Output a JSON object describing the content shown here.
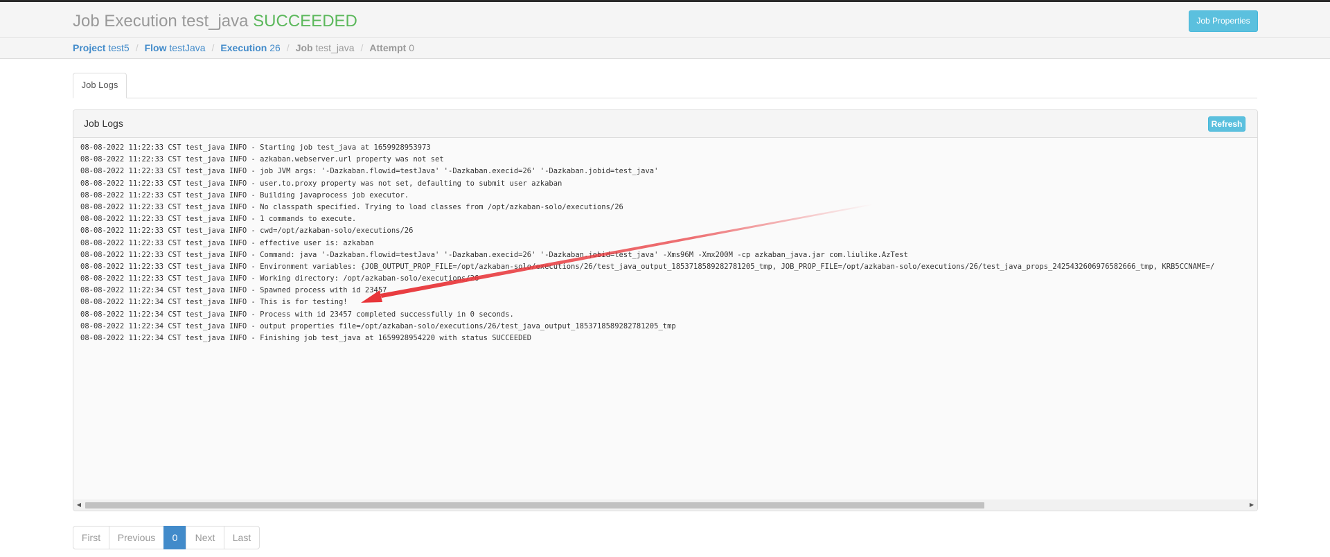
{
  "header": {
    "title_prefix": "Job Execution test_java",
    "status": "SUCCEEDED",
    "status_color": "#5cb85c",
    "job_properties_label": "Job Properties"
  },
  "breadcrumb": {
    "project": {
      "key": "Project",
      "value": "test5"
    },
    "flow": {
      "key": "Flow",
      "value": "testJava"
    },
    "execution": {
      "key": "Execution",
      "value": "26"
    },
    "job": {
      "key": "Job",
      "value": "test_java"
    },
    "attempt": {
      "key": "Attempt",
      "value": "0"
    },
    "separator": "/"
  },
  "tabs": [
    {
      "label": "Job Logs"
    }
  ],
  "panel": {
    "title": "Job Logs",
    "refresh_label": "Refresh"
  },
  "log_lines": [
    "08-08-2022 11:22:33 CST test_java INFO - Starting job test_java at 1659928953973",
    "08-08-2022 11:22:33 CST test_java INFO - azkaban.webserver.url property was not set",
    "08-08-2022 11:22:33 CST test_java INFO - job JVM args: '-Dazkaban.flowid=testJava' '-Dazkaban.execid=26' '-Dazkaban.jobid=test_java'",
    "08-08-2022 11:22:33 CST test_java INFO - user.to.proxy property was not set, defaulting to submit user azkaban",
    "08-08-2022 11:22:33 CST test_java INFO - Building javaprocess job executor.",
    "08-08-2022 11:22:33 CST test_java INFO - No classpath specified. Trying to load classes from /opt/azkaban-solo/executions/26",
    "08-08-2022 11:22:33 CST test_java INFO - 1 commands to execute.",
    "08-08-2022 11:22:33 CST test_java INFO - cwd=/opt/azkaban-solo/executions/26",
    "08-08-2022 11:22:33 CST test_java INFO - effective user is: azkaban",
    "08-08-2022 11:22:33 CST test_java INFO - Command: java '-Dazkaban.flowid=testJava' '-Dazkaban.execid=26' '-Dazkaban.jobid=test_java' -Xms96M -Xmx200M -cp azkaban_java.jar com.liulike.AzTest",
    "08-08-2022 11:22:33 CST test_java INFO - Environment variables: {JOB_OUTPUT_PROP_FILE=/opt/azkaban-solo/executions/26/test_java_output_1853718589282781205_tmp, JOB_PROP_FILE=/opt/azkaban-solo/executions/26/test_java_props_2425432606976582666_tmp, KRB5CCNAME=/",
    "08-08-2022 11:22:33 CST test_java INFO - Working directory: /opt/azkaban-solo/executions/26",
    "08-08-2022 11:22:34 CST test_java INFO - Spawned process with id 23457",
    "08-08-2022 11:22:34 CST test_java INFO - This is for testing!",
    "08-08-2022 11:22:34 CST test_java INFO - Process with id 23457 completed successfully in 0 seconds.",
    "08-08-2022 11:22:34 CST test_java INFO - output properties file=/opt/azkaban-solo/executions/26/test_java_output_1853718589282781205_tmp",
    "08-08-2022 11:22:34 CST test_java INFO - Finishing job test_java at 1659928954220 with status SUCCEEDED"
  ],
  "scrollbar": {
    "left_icon": "scroll-left-arrow-icon",
    "right_icon": "scroll-right-arrow-icon"
  },
  "annotation": {
    "icon": "red-arrow-annotation-icon",
    "color": "#e8363a"
  },
  "pagination": {
    "first": "First",
    "previous": "Previous",
    "current": "0",
    "next": "Next",
    "last": "Last"
  }
}
